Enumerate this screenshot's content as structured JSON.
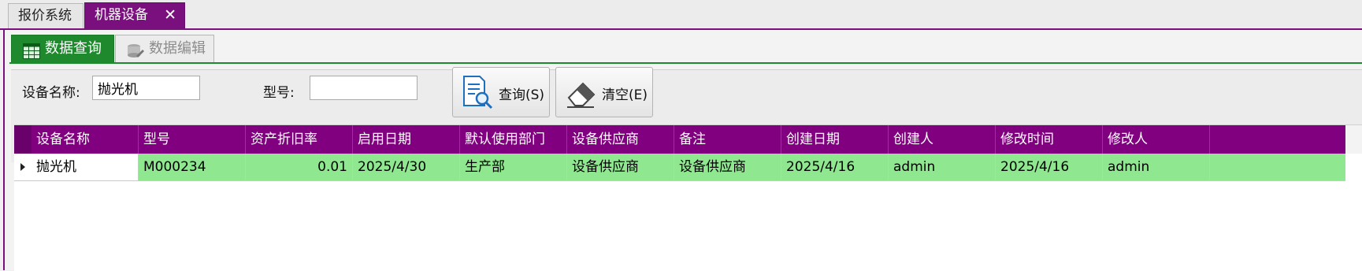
{
  "doc_tabs": [
    {
      "label": "报价系统",
      "active": false
    },
    {
      "label": "机器设备",
      "active": true,
      "close": "✕"
    }
  ],
  "sub_tabs": [
    {
      "label": "数据查询",
      "icon": "table-grid-icon",
      "active": true
    },
    {
      "label": "数据编辑",
      "icon": "database-edit-icon",
      "active": false
    }
  ],
  "search": {
    "device_name_label": "设备名称:",
    "device_name_value": "抛光机",
    "model_label": "型号:",
    "model_value": "",
    "query_button": "查询(S)",
    "clear_button": "清空(E)"
  },
  "grid": {
    "columns": [
      "设备名称",
      "型号",
      "资产折旧率",
      "启用日期",
      "默认使用部门",
      "设备供应商",
      "备注",
      "创建日期",
      "创建人",
      "修改时间",
      "修改人"
    ],
    "rows": [
      [
        "抛光机",
        "M000234",
        "0.01",
        "2025/4/30",
        "生产部",
        "设备供应商",
        "设备供应商",
        "2025/4/16",
        "admin",
        "2025/4/16",
        "admin"
      ]
    ]
  },
  "colors": {
    "accent_purple": "#800080",
    "active_tab_green": "#1e8a2d",
    "selected_row": "#8fe890"
  }
}
